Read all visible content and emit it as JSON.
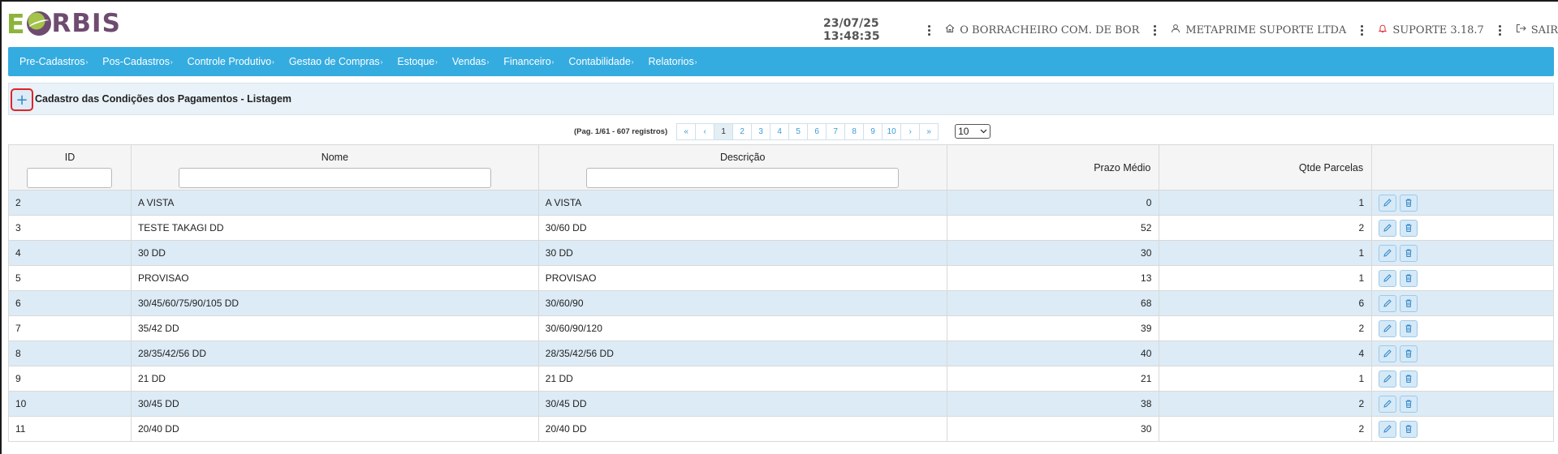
{
  "logo": {
    "text_left": "E",
    "text_right": "RBIS"
  },
  "header": {
    "datetime": "23/07/25 13:48:35",
    "company": "O BORRACHEIRO COM. DE BOR",
    "user": "METAPRIME SUPORTE LTDA",
    "support": "SUPORTE 3.18.7",
    "logout": "SAIR",
    "icons": {
      "company": "home-icon",
      "user": "user-icon",
      "support": "bell-icon",
      "logout": "logout-icon"
    }
  },
  "menu": [
    {
      "label": "Pre-Cadastros"
    },
    {
      "label": "Pos-Cadastros"
    },
    {
      "label": "Controle Produtivo"
    },
    {
      "label": "Gestao de Compras"
    },
    {
      "label": "Estoque"
    },
    {
      "label": "Vendas"
    },
    {
      "label": "Financeiro"
    },
    {
      "label": "Contabilidade"
    },
    {
      "label": "Relatorios"
    }
  ],
  "page": {
    "title": "Cadastro das Condições dos Pagamentos - Listagem",
    "add_symbol": "+"
  },
  "pagination": {
    "info": "(Pag. 1/61 - 607 registros)",
    "first": "«",
    "prev": "‹",
    "pages": [
      "1",
      "2",
      "3",
      "4",
      "5",
      "6",
      "7",
      "8",
      "9",
      "10"
    ],
    "current": "1",
    "next": "›",
    "last": "»",
    "page_size": "10"
  },
  "table": {
    "columns": {
      "id": "ID",
      "nome": "Nome",
      "descricao": "Descrição",
      "prazo": "Prazo Médio",
      "parcelas": "Qtde Parcelas"
    },
    "rows": [
      {
        "id": "2",
        "nome": "A VISTA",
        "descricao": "A VISTA",
        "prazo": "0",
        "parcelas": "1"
      },
      {
        "id": "3",
        "nome": "TESTE TAKAGI DD",
        "descricao": "30/60 DD",
        "prazo": "52",
        "parcelas": "2"
      },
      {
        "id": "4",
        "nome": "30 DD",
        "descricao": "30 DD",
        "prazo": "30",
        "parcelas": "1"
      },
      {
        "id": "5",
        "nome": "PROVISAO",
        "descricao": "PROVISAO",
        "prazo": "13",
        "parcelas": "1"
      },
      {
        "id": "6",
        "nome": "30/45/60/75/90/105 DD",
        "descricao": "30/60/90",
        "prazo": "68",
        "parcelas": "6"
      },
      {
        "id": "7",
        "nome": "35/42 DD",
        "descricao": "30/60/90/120",
        "prazo": "39",
        "parcelas": "2"
      },
      {
        "id": "8",
        "nome": "28/35/42/56 DD",
        "descricao": "28/35/42/56 DD",
        "prazo": "40",
        "parcelas": "4"
      },
      {
        "id": "9",
        "nome": "21 DD",
        "descricao": "21 DD",
        "prazo": "21",
        "parcelas": "1"
      },
      {
        "id": "10",
        "nome": "30/45 DD",
        "descricao": "30/45 DD",
        "prazo": "38",
        "parcelas": "2"
      },
      {
        "id": "11",
        "nome": "20/40 DD",
        "descricao": "20/40 DD",
        "prazo": "30",
        "parcelas": "2"
      }
    ]
  },
  "colors": {
    "menubar": "#35ace0",
    "row_alt": "#dcebf6",
    "accent_red": "#e0242a"
  }
}
